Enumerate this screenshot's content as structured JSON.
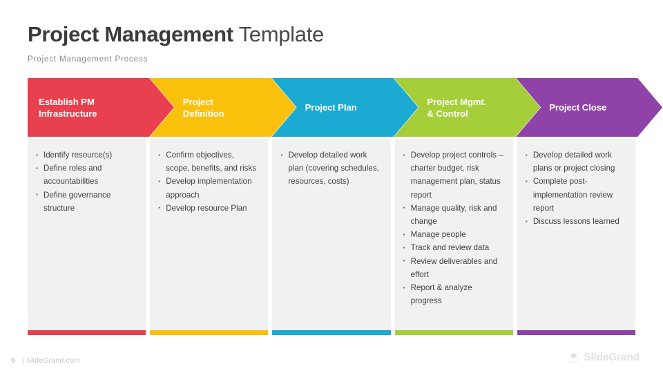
{
  "header": {
    "title_bold": "Project Management",
    "title_light": "Template",
    "subtitle": "Project  Management  Process"
  },
  "colors": {
    "red": "#E8404F",
    "yellow": "#F9C00C",
    "cyan": "#1BABD2",
    "green": "#A5CE39",
    "purple": "#8F43A8",
    "panel": "#F1F1F1",
    "title": "#3B3B3B",
    "body_text": "#3F3F3F",
    "subtitle": "#8A8A8A"
  },
  "phases": [
    {
      "label": "Establish PM\nInfrastructure",
      "color": "#E8404F",
      "bullets": [
        "Identify resource(s)",
        "Define roles  and accountabilities",
        "Define governance structure"
      ]
    },
    {
      "label": "Project\nDefinition",
      "color": "#F9C00C",
      "bullets": [
        "Confirm  objectives, scope, benefits, and risks",
        "Develop implementation approach",
        "Develop resource Plan"
      ]
    },
    {
      "label": "Project Plan",
      "color": "#1BABD2",
      "bullets": [
        "Develop detailed  work plan (covering schedules, resources, costs)"
      ]
    },
    {
      "label": "Project Mgmt.\n & Control",
      "color": "#A5CE39",
      "bullets": [
        "Develop project controls – charter budget, risk management  plan, status report",
        "Manage quality,  risk and change",
        "Manage people",
        "Track and review data",
        "Review deliverables and effort",
        "Report & analyze progress"
      ]
    },
    {
      "label": "Project Close",
      "color": "#8F43A8",
      "bullets": [
        "Develop detailed  work plans or project closing",
        "Complete  post-implementation review report",
        "Discuss lessons learned"
      ]
    }
  ],
  "footer": {
    "page_number": "6",
    "site": "| SlideGrand.com",
    "brand_name": "SlideGrand",
    "brand_icon": "slidegrand-logo-icon"
  }
}
